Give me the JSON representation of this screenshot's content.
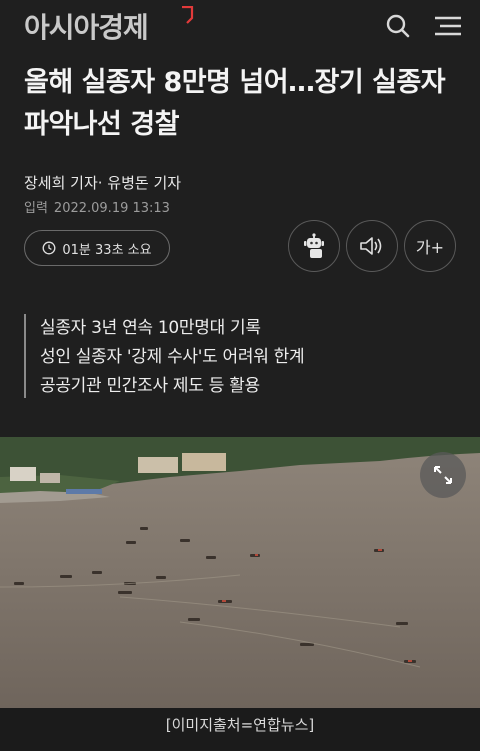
{
  "header": {
    "logo_text": "아시아경제",
    "logo_accent_color": "#e23a3a",
    "search_icon": "search-icon",
    "menu_icon": "hamburger-menu-icon"
  },
  "article": {
    "title": "올해 실종자 8만명 넘어…장기 실종자 파악나선 경찰",
    "byline": "장세희 기자· 유병돈 기자",
    "date_label": "입력",
    "date_value": "2022.09.19 13:13",
    "read_time": "01분 33초 소요",
    "font_button_label": "가+",
    "summary": [
      "실종자 3년 연속 10만명대 기록",
      "성인 실종자 '강제 수사'도 어려워 한계",
      "공공기관 민간조사 제도 등 활용"
    ],
    "photo_caption": "[이미지출처=연합뉴스]"
  },
  "toolbar": {
    "robot_icon": "ai-robot-icon",
    "audio_icon": "speaker-icon",
    "clock_icon": "clock-icon",
    "expand_icon": "expand-arrows-icon"
  }
}
